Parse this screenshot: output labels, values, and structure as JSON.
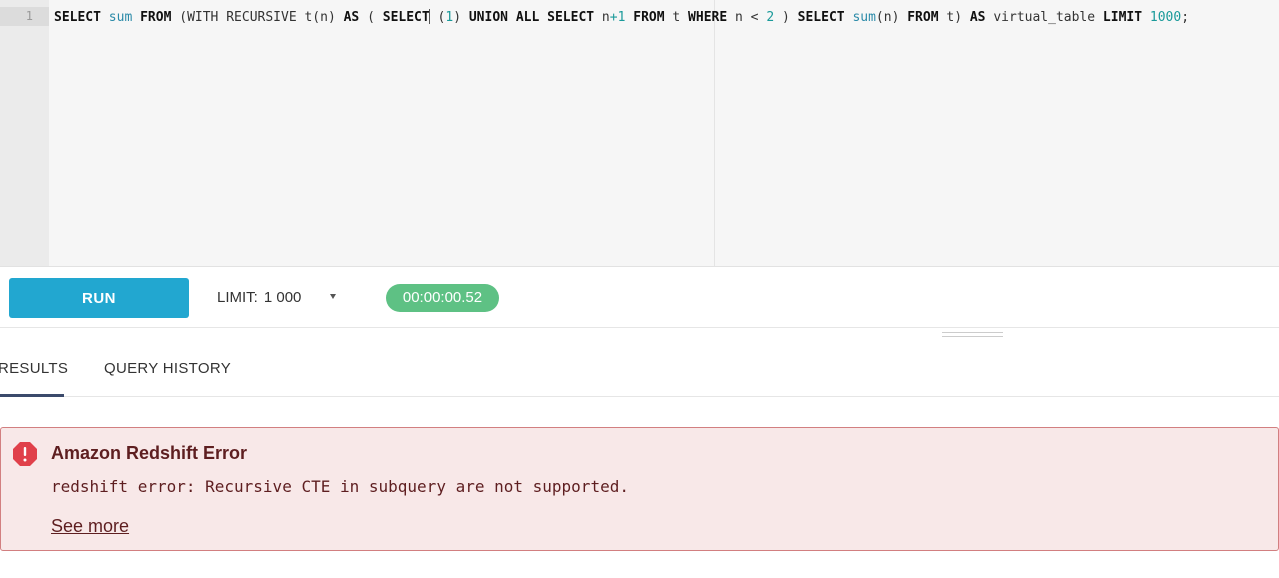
{
  "editor": {
    "line_number": "1",
    "tokens": [
      {
        "t": "SELECT",
        "c": "kw"
      },
      {
        "t": " ",
        "c": "id"
      },
      {
        "t": "sum",
        "c": "fn"
      },
      {
        "t": " ",
        "c": "id"
      },
      {
        "t": "FROM",
        "c": "kw"
      },
      {
        "t": " (WITH RECURSIVE t(n) ",
        "c": "id"
      },
      {
        "t": "AS",
        "c": "kw"
      },
      {
        "t": " ( ",
        "c": "id"
      },
      {
        "t": "SELECT",
        "c": "kw"
      },
      {
        "t": "CURSOR",
        "c": "cursor"
      },
      {
        "t": " (",
        "c": "id"
      },
      {
        "t": "1",
        "c": "num"
      },
      {
        "t": ") ",
        "c": "id"
      },
      {
        "t": "UNION ALL",
        "c": "kw"
      },
      {
        "t": " ",
        "c": "id"
      },
      {
        "t": "SELECT",
        "c": "kw"
      },
      {
        "t": " n",
        "c": "id"
      },
      {
        "t": "+1",
        "c": "num"
      },
      {
        "t": " ",
        "c": "id"
      },
      {
        "t": "FROM",
        "c": "kw"
      },
      {
        "t": " t ",
        "c": "id"
      },
      {
        "t": "WHERE",
        "c": "kw"
      },
      {
        "t": " n < ",
        "c": "id"
      },
      {
        "t": "2",
        "c": "num"
      },
      {
        "t": " ) ",
        "c": "id"
      },
      {
        "t": "SELECT",
        "c": "kw"
      },
      {
        "t": " ",
        "c": "id"
      },
      {
        "t": "sum",
        "c": "fn"
      },
      {
        "t": "(n) ",
        "c": "id"
      },
      {
        "t": "FROM",
        "c": "kw"
      },
      {
        "t": " t) ",
        "c": "id"
      },
      {
        "t": "AS",
        "c": "kw"
      },
      {
        "t": " virtual_table ",
        "c": "id"
      },
      {
        "t": "LIMIT",
        "c": "kw"
      },
      {
        "t": " ",
        "c": "id"
      },
      {
        "t": "1000",
        "c": "num"
      },
      {
        "t": ";",
        "c": "id"
      }
    ]
  },
  "toolbar": {
    "run_label": "RUN",
    "limit_label": "LIMIT:",
    "limit_value": "1 000",
    "timer": "00:00:00.52"
  },
  "tabs": {
    "results": "RESULTS",
    "history": "QUERY HISTORY"
  },
  "error": {
    "title": "Amazon Redshift Error",
    "message": "redshift error: Recursive CTE in subquery are not supported.",
    "link": "See more"
  },
  "colors": {
    "run_button": "#22a7d0",
    "timer_badge": "#5ec184",
    "error_bg": "#f8e8e8",
    "error_border": "#d27f80",
    "error_icon": "#e0404a",
    "tab_underline": "#3b4a6b"
  },
  "icons": {
    "error": "error-octagon-icon",
    "limit_dropdown": "caret-down-icon"
  }
}
